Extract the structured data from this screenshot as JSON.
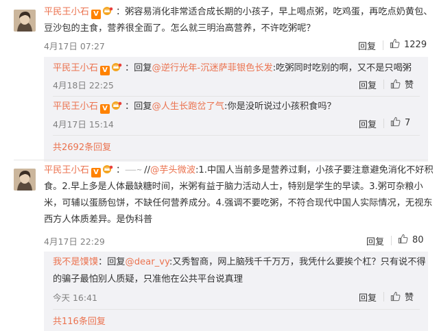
{
  "comment1": {
    "username": "平民王小石",
    "text_line1": "：粥容易消化非常适合成长期的小孩子，早上喝点粥，吃鸡蛋，再吃点奶黄包、",
    "text_line2": "豆沙包的主食，营养很全面了。怎么就三明治高营养，不许吃粥呢？",
    "time": "4月17日 07:27",
    "reply_label": "回复",
    "like_count": "1229",
    "replies": [
      {
        "username": "平民王小石",
        "reply_prefix": "：回复",
        "mention": "@逆行光年-沉迷萨菲银色长发",
        "text": ":吃粥同时吃别的啊，又不是只喝粥",
        "time": "4月18日 22:25",
        "reply_label": "回复",
        "like_label": "赞"
      },
      {
        "username": "平民王小石",
        "reply_prefix": "：回复",
        "mention": "@人生长跑岔了气",
        "text": ":你是没听说过小孩积食吗？",
        "time": "4月17日 15:14",
        "reply_label": "回复",
        "like_label": "7"
      }
    ],
    "more_replies": "共2692条回复"
  },
  "comment2": {
    "username": "平民王小石",
    "text_prefix": "：",
    "text_mid": "//",
    "mention": "@芋头微波",
    "text_line1_rest": ":1.中国人当前多是营养过剩，小孩子要注意避免消化不好积",
    "text_line2": "食。2.早上多是人体最缺糖时间，米粥有益于脑力活动人士，特别是学生的早读。3.粥可杂粮小",
    "text_line3": "米，可辅以蛋肠包饼，不缺任何营养成分。4.强调不要吃粥，不符合现代中国人实际情况，无视东",
    "text_line4": "西方人体质差异。是伪科普",
    "time": "4月17日 22:29",
    "reply_label": "回复",
    "like_count": "80",
    "replies": [
      {
        "username": "我不是馍馍",
        "reply_prefix": "：回复",
        "mention": "@dear_vy",
        "text_line1": ":又秀智商，网上脑残千千万万，我凭什么要挨个杠？只有说不得",
        "text_line2": "的骗子最怕别人质疑，只准他在公共平台说真理",
        "time": "今天 16:41",
        "reply_label": "回复",
        "like_label": "赞"
      }
    ],
    "more_replies": "共116条回复"
  },
  "colors": {
    "accent": "#eb7350",
    "badge": "#ff8200",
    "subbox_bg": "#f2f2f5",
    "time_gray": "#808080"
  },
  "icons": {
    "verified": "verified-v-icon",
    "vip": "vip-crown-icon",
    "like": "thumbs-up-icon"
  }
}
